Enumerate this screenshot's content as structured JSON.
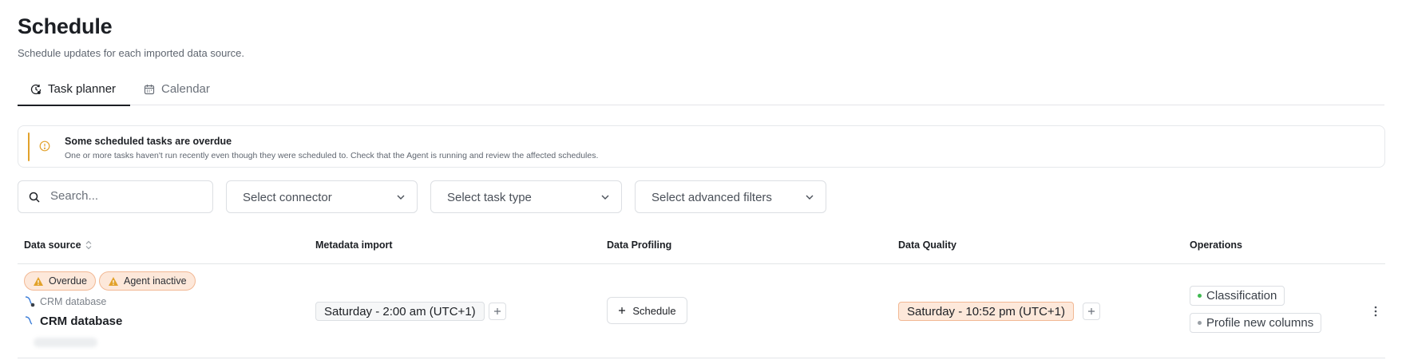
{
  "page": {
    "title": "Schedule",
    "subtitle": "Schedule updates for each imported data source."
  },
  "tabs": [
    {
      "label": "Task planner",
      "icon": "clock-refresh-icon",
      "active": true
    },
    {
      "label": "Calendar",
      "icon": "calendar-icon",
      "active": false
    }
  ],
  "alert": {
    "title": "Some scheduled tasks are overdue",
    "description": "One or more tasks haven't run recently even though they were scheduled to. Check that the Agent is running and review the affected schedules.",
    "icon": "warning-circle-icon",
    "accent_color": "#e2a22b"
  },
  "filters": {
    "search_placeholder": "Search...",
    "connector_placeholder": "Select connector",
    "task_type_placeholder": "Select task type",
    "advanced_placeholder": "Select advanced filters"
  },
  "table": {
    "columns": [
      "Data source",
      "Metadata import",
      "Data Profiling",
      "Data Quality",
      "Operations"
    ],
    "rows": [
      {
        "badges": [
          "Overdue",
          "Agent inactive"
        ],
        "source_sub": "CRM database",
        "source_name": "CRM database",
        "metadata_import": "Saturday - 2:00 am (UTC+1)",
        "data_profiling_button": "Schedule",
        "data_quality": "Saturday - 10:52 pm (UTC+1)",
        "operations": [
          {
            "label": "Classification",
            "status_color": "#3fb950"
          },
          {
            "label": "Profile new columns",
            "status_color": "#9aa0a6"
          }
        ]
      }
    ]
  },
  "colors": {
    "warning_bg": "#fde8da",
    "warning_border": "#f2b894",
    "warning_icon": "#e2a22b"
  }
}
